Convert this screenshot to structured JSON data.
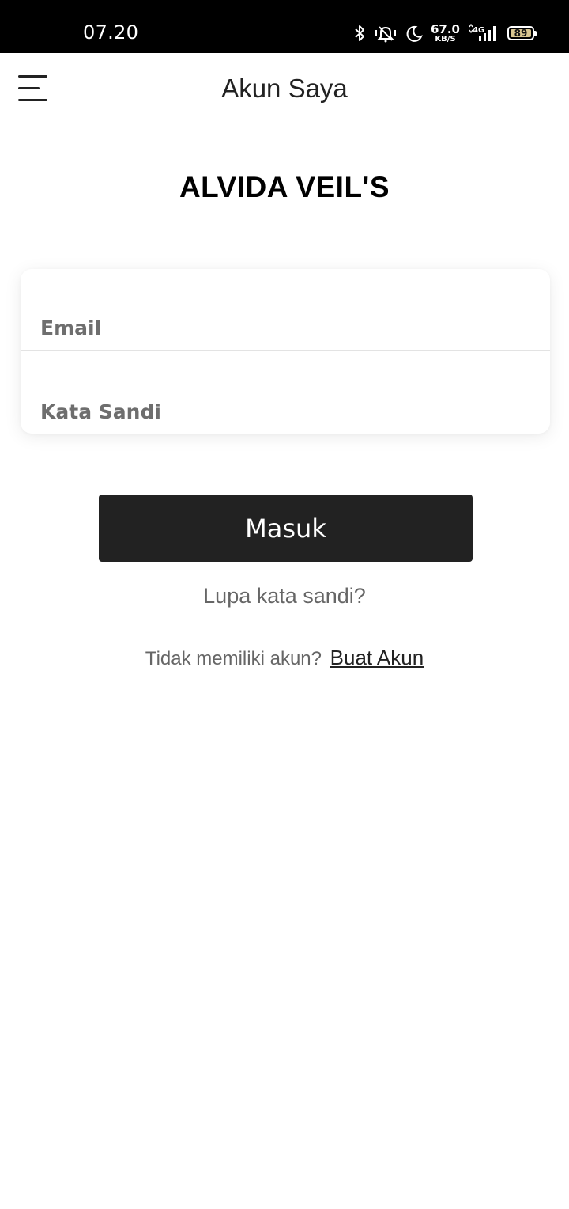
{
  "status_bar": {
    "time": "07.20",
    "net_speed_value": "67.0",
    "net_speed_unit": "KB/S",
    "network_type": "4G",
    "battery_level": "89",
    "icons": [
      "bluetooth-icon",
      "vibrate-mute-icon",
      "do-not-disturb-moon-icon",
      "signal-icon",
      "battery-icon"
    ]
  },
  "header": {
    "menu_icon": "hamburger-menu-icon",
    "title": "Akun Saya"
  },
  "brand": {
    "name": "ALVIDA VEIL'S"
  },
  "login_form": {
    "email": {
      "value": "",
      "placeholder": "Email"
    },
    "password": {
      "value": "",
      "placeholder": "Kata Sandi"
    }
  },
  "actions": {
    "login_label": "Masuk",
    "forgot_password": "Lupa kata sandi?",
    "no_account_text": "Tidak memiliki akun?",
    "signup_link": "Buat Akun"
  },
  "colors": {
    "status_bar_bg": "#000000",
    "button_bg": "#222222",
    "text_muted": "#666666"
  }
}
